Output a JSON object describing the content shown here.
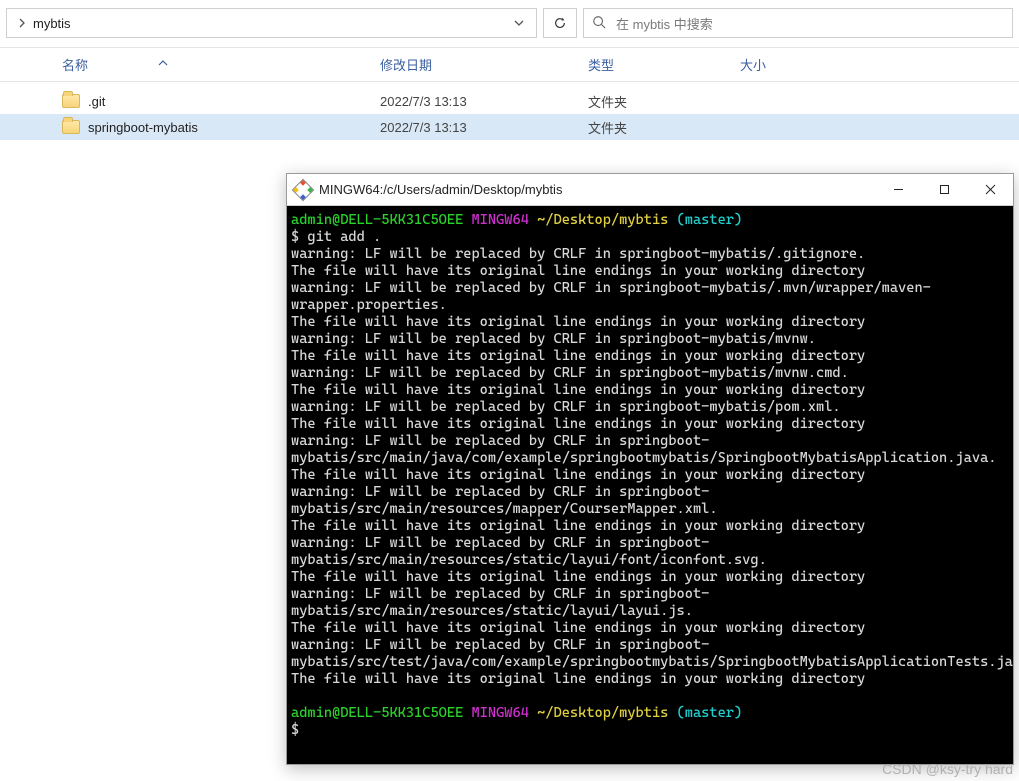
{
  "explorer": {
    "breadcrumb": "mybtis",
    "search_placeholder": "在 mybtis 中搜索",
    "columns": {
      "name": "名称",
      "modified": "修改日期",
      "type": "类型",
      "size": "大小"
    },
    "rows": [
      {
        "name": ".git",
        "modified": "2022/7/3 13:13",
        "type": "文件夹",
        "selected": false
      },
      {
        "name": "springboot-mybatis",
        "modified": "2022/7/3 13:13",
        "type": "文件夹",
        "selected": true
      }
    ]
  },
  "terminal": {
    "title": "MINGW64:/c/Users/admin/Desktop/mybtis",
    "prompt": {
      "user": "admin@DELL-5KK31C5OEE",
      "host": "MINGW64",
      "path": "~/Desktop/mybtis",
      "branch": "(master)"
    },
    "command": "$ git add .",
    "final_prompt_dollar": "$",
    "lines": [
      "warning: LF will be replaced by CRLF in springboot-mybatis/.gitignore.",
      "The file will have its original line endings in your working directory",
      "warning: LF will be replaced by CRLF in springboot-mybatis/.mvn/wrapper/maven-wrapper.properties.",
      "The file will have its original line endings in your working directory",
      "warning: LF will be replaced by CRLF in springboot-mybatis/mvnw.",
      "The file will have its original line endings in your working directory",
      "warning: LF will be replaced by CRLF in springboot-mybatis/mvnw.cmd.",
      "The file will have its original line endings in your working directory",
      "warning: LF will be replaced by CRLF in springboot-mybatis/pom.xml.",
      "The file will have its original line endings in your working directory",
      "warning: LF will be replaced by CRLF in springboot-mybatis/src/main/java/com/example/springbootmybatis/SpringbootMybatisApplication.java.",
      "The file will have its original line endings in your working directory",
      "warning: LF will be replaced by CRLF in springboot-mybatis/src/main/resources/mapper/CourserMapper.xml.",
      "The file will have its original line endings in your working directory",
      "warning: LF will be replaced by CRLF in springboot-mybatis/src/main/resources/static/layui/font/iconfont.svg.",
      "The file will have its original line endings in your working directory",
      "warning: LF will be replaced by CRLF in springboot-mybatis/src/main/resources/static/layui/layui.js.",
      "The file will have its original line endings in your working directory",
      "warning: LF will be replaced by CRLF in springboot-mybatis/src/test/java/com/example/springbootmybatis/SpringbootMybatisApplicationTests.java.",
      "The file will have its original line endings in your working directory"
    ]
  },
  "watermark": "CSDN @ksy-try hard"
}
